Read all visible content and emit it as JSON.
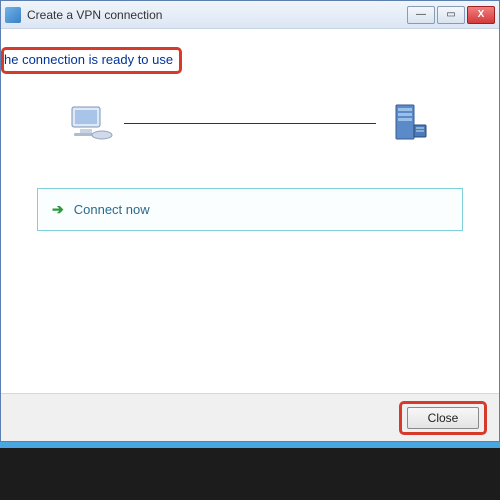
{
  "window": {
    "title": "Create a VPN connection"
  },
  "headline": "he connection is ready to use",
  "action": {
    "label": "Connect now"
  },
  "footer": {
    "close_label": "Close"
  },
  "titlebar_controls": {
    "minimize": "—",
    "maximize": "▭",
    "close": "X"
  }
}
